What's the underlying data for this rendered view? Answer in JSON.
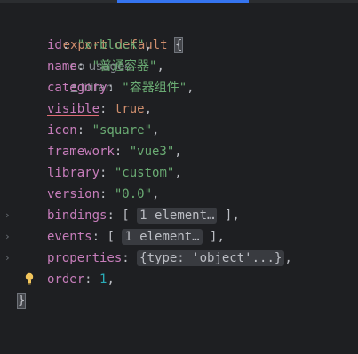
{
  "editor": {
    "line1": {
      "export_kw": "export",
      "default_kw": "default",
      "brace": "{",
      "inlay_usages": "no usages",
      "author": "lilifan"
    },
    "props": [
      {
        "key": "id",
        "value": "\"x-block\"",
        "type": "string"
      },
      {
        "key": "name",
        "value": "\"普通容器\"",
        "type": "string"
      },
      {
        "key": "category",
        "value": "\"容器组件\"",
        "type": "string"
      },
      {
        "key": "visible",
        "value": "true",
        "type": "keyword"
      },
      {
        "key": "icon",
        "value": "\"square\"",
        "type": "string"
      },
      {
        "key": "framework",
        "value": "\"vue3\"",
        "type": "string"
      },
      {
        "key": "library",
        "value": "\"custom\"",
        "type": "string"
      },
      {
        "key": "version",
        "value": "\"0.0\"",
        "type": "string"
      }
    ],
    "folded": [
      {
        "key": "bindings",
        "open": "[",
        "fold_text": "1 element…",
        "close": "]"
      },
      {
        "key": "events",
        "open": "[",
        "fold_text": "1 element…",
        "close": "]"
      },
      {
        "key": "properties",
        "fold_text": "{type: 'object'...}"
      }
    ],
    "order": {
      "key": "order",
      "value": "1"
    },
    "closing_brace": "}"
  },
  "colors": {
    "background": "#1e1f22",
    "keyword": "#cf8e6d",
    "property": "#c77dbb",
    "string": "#6aab73",
    "number": "#2aacb8",
    "accent": "#3574f0"
  }
}
